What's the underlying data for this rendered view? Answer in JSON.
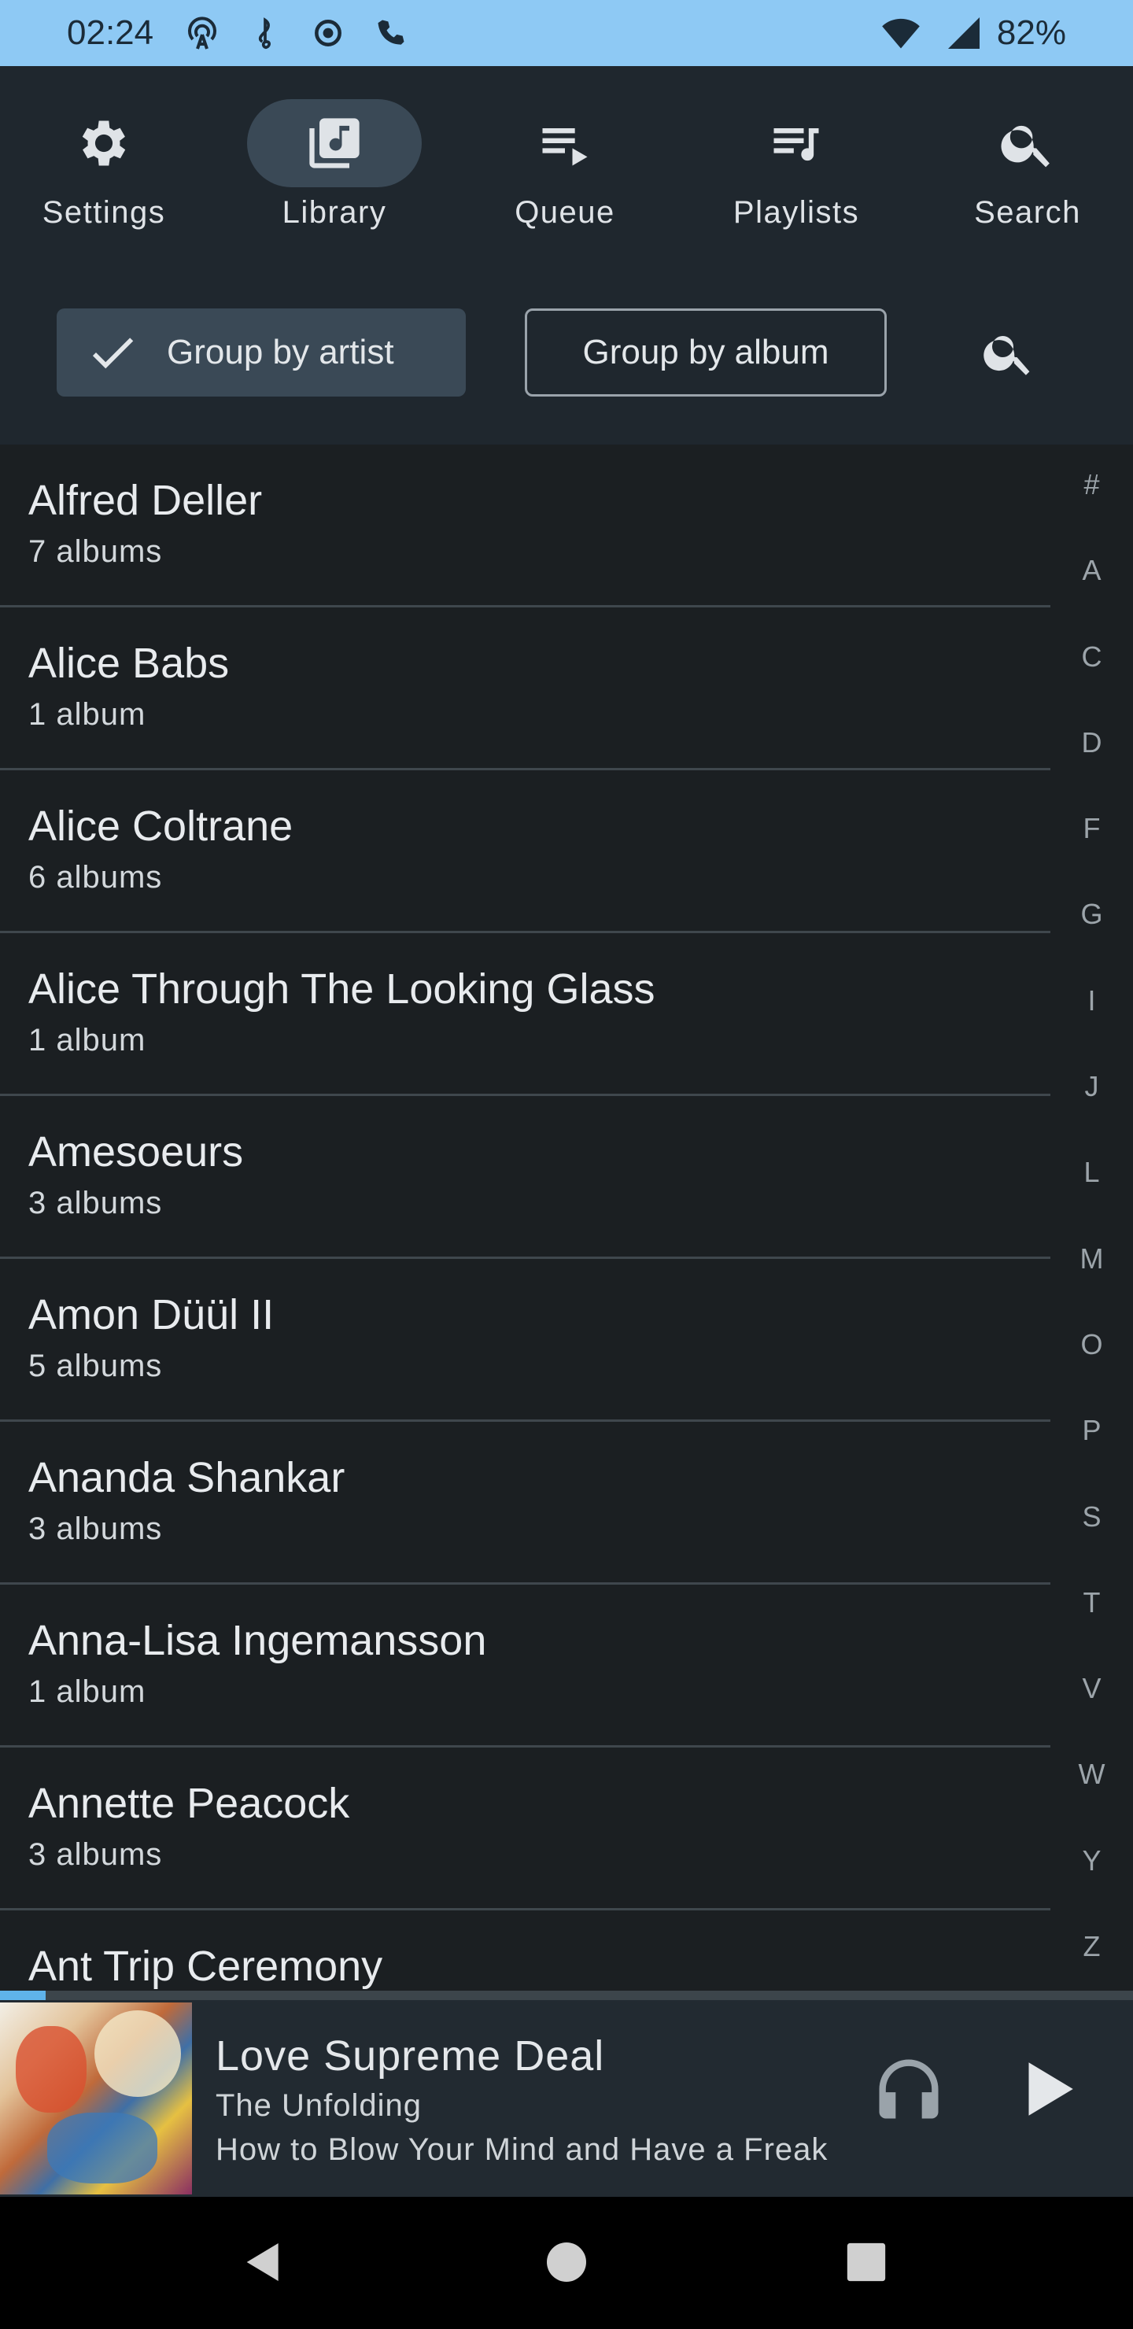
{
  "status_bar": {
    "time": "02:24",
    "icons": [
      "podcast-icon",
      "music-clef-icon",
      "record-icon",
      "phone-icon"
    ],
    "battery": "82%"
  },
  "nav": {
    "items": [
      {
        "label": "Settings",
        "icon": "gear-icon"
      },
      {
        "label": "Library",
        "icon": "library-music-icon",
        "active": true
      },
      {
        "label": "Queue",
        "icon": "queue-icon"
      },
      {
        "label": "Playlists",
        "icon": "playlist-icon"
      },
      {
        "label": "Search",
        "icon": "search-icon"
      }
    ]
  },
  "filters": {
    "group_by_artist": "Group by artist",
    "group_by_album": "Group by album"
  },
  "artists": [
    {
      "name": "Alfred Deller",
      "count": "7 albums"
    },
    {
      "name": "Alice Babs",
      "count": "1 album"
    },
    {
      "name": "Alice Coltrane",
      "count": "6 albums"
    },
    {
      "name": "Alice Through The Looking Glass",
      "count": "1 album"
    },
    {
      "name": "Amesoeurs",
      "count": "3 albums"
    },
    {
      "name": "Amon Düül II",
      "count": "5 albums"
    },
    {
      "name": "Ananda Shankar",
      "count": "3 albums"
    },
    {
      "name": "Anna-Lisa Ingemansson",
      "count": "1 album"
    },
    {
      "name": "Annette Peacock",
      "count": "3 albums"
    },
    {
      "name": "Ant Trip Ceremony",
      "count": ""
    }
  ],
  "alphabet": [
    "#",
    "A",
    "C",
    "D",
    "F",
    "G",
    "I",
    "J",
    "L",
    "M",
    "O",
    "P",
    "S",
    "T",
    "V",
    "W",
    "Y",
    "Z"
  ],
  "player": {
    "title": "Love Supreme Deal",
    "artist": "The Unfolding",
    "album": "How to Blow Your Mind and Have a Freak",
    "progress": 0.04
  },
  "colors": {
    "status_bar": "#8ec9f4",
    "header": "#1f272e",
    "background": "#1b1f22",
    "active_pill": "#3a4956",
    "progress": "#5fb3ea"
  }
}
